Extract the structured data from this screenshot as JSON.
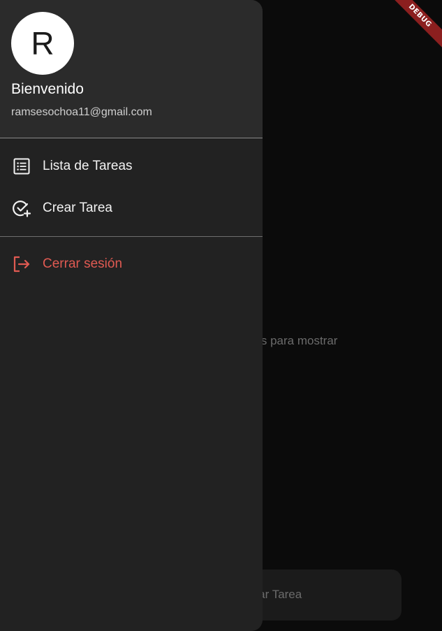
{
  "background": {
    "empty_text": "No hay tareas para mostrar",
    "bottom_button_label": "Crear Tarea"
  },
  "drawer": {
    "avatar_letter": "R",
    "title": "Bienvenido",
    "email": "ramsesochoa11@gmail.com",
    "items": [
      {
        "label": "Lista de Tareas",
        "icon": "list-icon"
      },
      {
        "label": "Crear Tarea",
        "icon": "check-add-icon"
      }
    ],
    "logout": {
      "label": "Cerrar sesión",
      "icon": "logout-icon",
      "color": "#e05a52"
    }
  },
  "debug_banner": "DEBUG",
  "colors": {
    "drawer_bg": "#222222",
    "header_bg": "#2b2b2b",
    "page_bg": "#0b0b0b",
    "danger": "#e05a52",
    "debug": "#8b1f1f"
  }
}
